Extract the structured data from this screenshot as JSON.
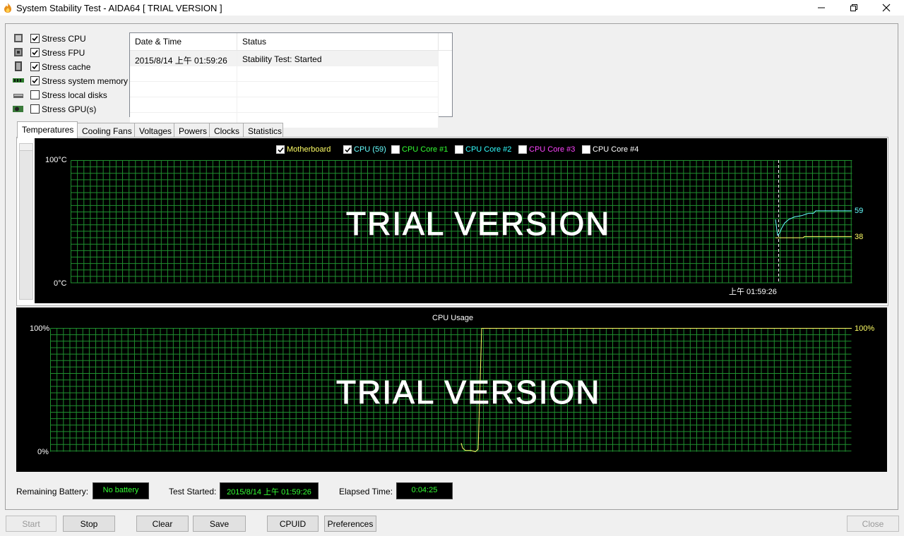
{
  "window": {
    "title": "System Stability Test - AIDA64  [ TRIAL VERSION ]"
  },
  "stress_options": [
    {
      "label": "Stress CPU",
      "checked": true,
      "icon": "cpu-icon"
    },
    {
      "label": "Stress FPU",
      "checked": true,
      "icon": "fpu-icon"
    },
    {
      "label": "Stress cache",
      "checked": true,
      "icon": "cache-icon"
    },
    {
      "label": "Stress system memory",
      "checked": true,
      "icon": "memory-icon"
    },
    {
      "label": "Stress local disks",
      "checked": false,
      "icon": "disk-icon"
    },
    {
      "label": "Stress GPU(s)",
      "checked": false,
      "icon": "gpu-icon"
    }
  ],
  "log": {
    "columns": [
      "Date & Time",
      "Status"
    ],
    "rows": [
      {
        "datetime": "2015/8/14 上午 01:59:26",
        "status": "Stability Test: Started"
      }
    ]
  },
  "tabs": [
    "Temperatures",
    "Cooling Fans",
    "Voltages",
    "Powers",
    "Clocks",
    "Statistics"
  ],
  "active_tab": "Temperatures",
  "temperature_graph": {
    "legend": [
      {
        "label": "Motherboard",
        "checked": true,
        "color": "#ffff66"
      },
      {
        "label": "CPU (59)",
        "checked": true,
        "color": "#66ffff"
      },
      {
        "label": "CPU Core #1",
        "checked": false,
        "color": "#33ff33"
      },
      {
        "label": "CPU Core #2",
        "checked": false,
        "color": "#33ffff"
      },
      {
        "label": "CPU Core #3",
        "checked": false,
        "color": "#ff44ff"
      },
      {
        "label": "CPU Core #4",
        "checked": false,
        "color": "#ffffff"
      }
    ],
    "y_max_label": "100°C",
    "y_min_label": "0°C",
    "time_label": "上午 01:59:26",
    "watermark": "TRIAL VERSION",
    "current_values": {
      "cpu": "59",
      "motherboard": "38"
    },
    "cpu_value": 59,
    "motherboard_value": 38
  },
  "usage_graph": {
    "title": "CPU Usage",
    "y_max_label": "100%",
    "y_min_label": "0%",
    "current_value": "100%",
    "watermark": "TRIAL VERSION"
  },
  "status": {
    "battery_label": "Remaining Battery:",
    "battery_value": "No battery",
    "started_label": "Test Started:",
    "started_value": "2015/8/14 上午 01:59:26",
    "elapsed_label": "Elapsed Time:",
    "elapsed_value": "0:04:25"
  },
  "buttons": {
    "start": "Start",
    "stop": "Stop",
    "clear": "Clear",
    "save": "Save",
    "cpuid": "CPUID",
    "preferences": "Preferences",
    "close": "Close"
  },
  "colors": {
    "grid": "#1f8f2f",
    "cpu_line": "#66ffff",
    "motherboard_line": "#ffff66",
    "usage_line": "#ffff66",
    "status_text": "#33ff33"
  }
}
